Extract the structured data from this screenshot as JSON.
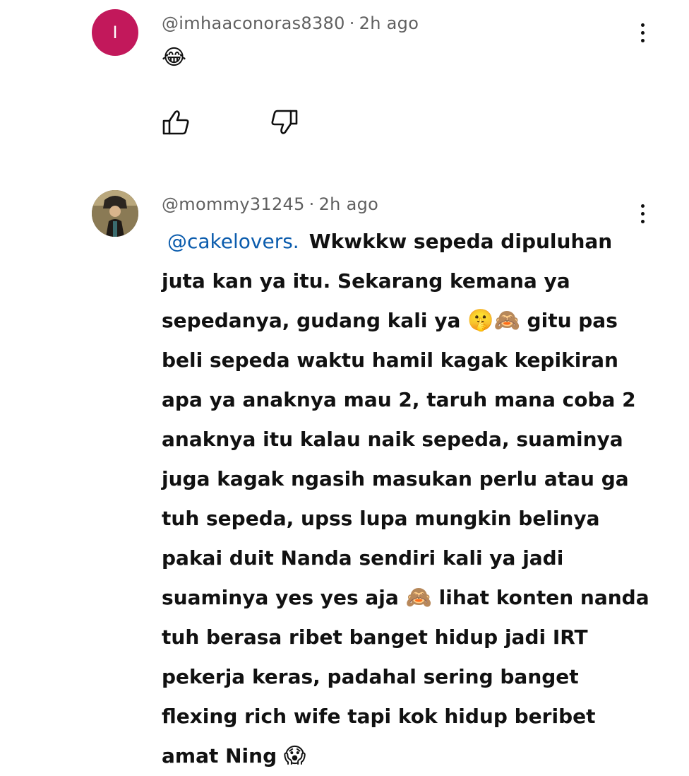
{
  "comments": [
    {
      "avatar_letter": "I",
      "avatar_color": "#c2185b",
      "username": "@imhaaconoras8380",
      "time": "2h ago",
      "text_emoji": "😂"
    },
    {
      "username": "@mommy31245",
      "time": "2h ago",
      "mention": "@cakelovers.",
      "text_parts": [
        "Wkwkkw sepeda dipuluhan juta kan ya itu. Sekarang kemana ya sepedanya, gudang kali ya ",
        "🤫🙈",
        " gitu pas beli sepeda waktu hamil kagak kepikiran apa ya anaknya mau 2, taruh mana coba 2 anaknya itu kalau naik sepeda, suaminya juga kagak ngasih masukan perlu atau ga tuh sepeda, upss lupa mungkin belinya pakai duit Nanda sendiri kali ya jadi suaminya yes yes aja ",
        "🙈",
        " lihat konten nanda tuh berasa ribet banget hidup jadi IRT pekerja keras, padahal sering banget flexing rich wife tapi kok hidup beribet amat Ning ",
        "😱"
      ]
    }
  ],
  "icons": {
    "like": "thumbs-up-icon",
    "dislike": "thumbs-down-icon",
    "more": "more-vertical-icon"
  }
}
